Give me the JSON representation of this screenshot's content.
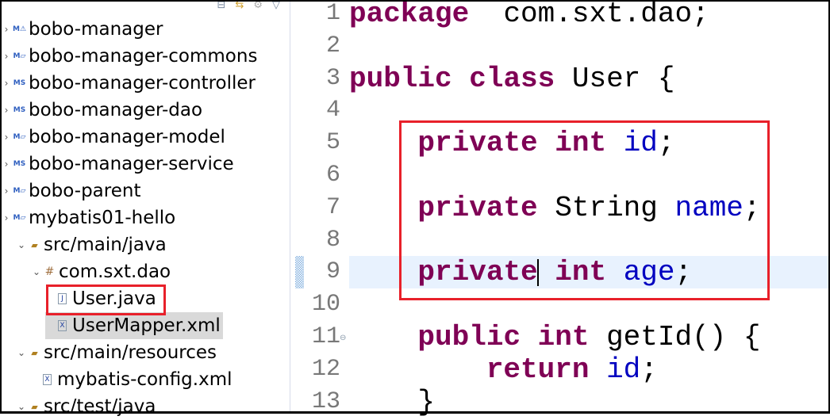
{
  "explorer": {
    "toolbar": [
      "collapse-all-icon",
      "link-with-editor-icon",
      "focus-icon",
      "view-menu-icon"
    ],
    "items": [
      {
        "label": "bobo-manager",
        "icon": "maven-project-warning-icon",
        "depth": 0
      },
      {
        "label": "bobo-manager-commons",
        "icon": "maven-project-icon",
        "depth": 0
      },
      {
        "label": "bobo-manager-controller",
        "icon": "maven-spring-project-icon",
        "depth": 0
      },
      {
        "label": "bobo-manager-dao",
        "icon": "maven-spring-project-icon",
        "depth": 0
      },
      {
        "label": "bobo-manager-model",
        "icon": "maven-project-icon",
        "depth": 0
      },
      {
        "label": "bobo-manager-service",
        "icon": "maven-spring-project-icon",
        "depth": 0
      },
      {
        "label": "bobo-parent",
        "icon": "maven-project-icon",
        "depth": 0
      },
      {
        "label": "mybatis01-hello",
        "icon": "maven-project-icon",
        "depth": 0
      },
      {
        "label": "src/main/java",
        "icon": "source-folder-icon",
        "depth": 1
      },
      {
        "label": "com.sxt.dao",
        "icon": "package-icon",
        "depth": 2
      },
      {
        "label": "User.java",
        "icon": "java-file-icon",
        "depth": 3
      },
      {
        "label": "UserMapper.xml",
        "icon": "xml-file-icon",
        "depth": 3,
        "selected": true
      },
      {
        "label": "src/main/resources",
        "icon": "source-folder-icon",
        "depth": 1
      },
      {
        "label": "mybatis-config.xml",
        "icon": "xml-file-icon",
        "depth": 2
      },
      {
        "label": "src/test/java",
        "icon": "source-folder-icon",
        "depth": 1
      }
    ]
  },
  "editor": {
    "current_line": 9,
    "lines": [
      {
        "n": "1",
        "tokens": [
          [
            "kw",
            "package"
          ],
          [
            "",
            "  com.sxt.dao;"
          ]
        ]
      },
      {
        "n": "2",
        "tokens": []
      },
      {
        "n": "3",
        "tokens": [
          [
            "kw",
            "public"
          ],
          [
            "",
            " "
          ],
          [
            "kw",
            "class"
          ],
          [
            "",
            " User {"
          ]
        ]
      },
      {
        "n": "4",
        "tokens": []
      },
      {
        "n": "5",
        "tokens": [
          [
            "",
            "    "
          ],
          [
            "kw",
            "private"
          ],
          [
            "",
            " "
          ],
          [
            "kw",
            "int"
          ],
          [
            "",
            " "
          ],
          [
            "fld",
            "id"
          ],
          [
            "",
            ";"
          ]
        ]
      },
      {
        "n": "6",
        "tokens": []
      },
      {
        "n": "7",
        "tokens": [
          [
            "",
            "    "
          ],
          [
            "kw",
            "private"
          ],
          [
            "",
            " String "
          ],
          [
            "fld",
            "name"
          ],
          [
            "",
            ";"
          ]
        ]
      },
      {
        "n": "8",
        "tokens": []
      },
      {
        "n": "9",
        "tokens": [
          [
            "",
            "    "
          ],
          [
            "kw",
            "private"
          ],
          [
            "caret",
            ""
          ],
          [
            "",
            " "
          ],
          [
            "kw",
            "int"
          ],
          [
            "",
            " "
          ],
          [
            "fld",
            "age"
          ],
          [
            "",
            ";"
          ]
        ]
      },
      {
        "n": "10",
        "tokens": []
      },
      {
        "n": "11",
        "tokens": [
          [
            "",
            "    "
          ],
          [
            "kw",
            "public"
          ],
          [
            "",
            " "
          ],
          [
            "kw",
            "int"
          ],
          [
            "",
            " getId() {"
          ]
        ]
      },
      {
        "n": "12",
        "tokens": [
          [
            "",
            "        "
          ],
          [
            "kw",
            "return"
          ],
          [
            "",
            " "
          ],
          [
            "fld",
            "id"
          ],
          [
            "",
            ";"
          ]
        ]
      },
      {
        "n": "13",
        "tokens": [
          [
            "",
            "    }"
          ]
        ]
      }
    ]
  },
  "colors": {
    "keyword": "#7f0055",
    "field": "#0000c0",
    "highlight": "#e8202a",
    "current_line": "#e8f2fe"
  }
}
